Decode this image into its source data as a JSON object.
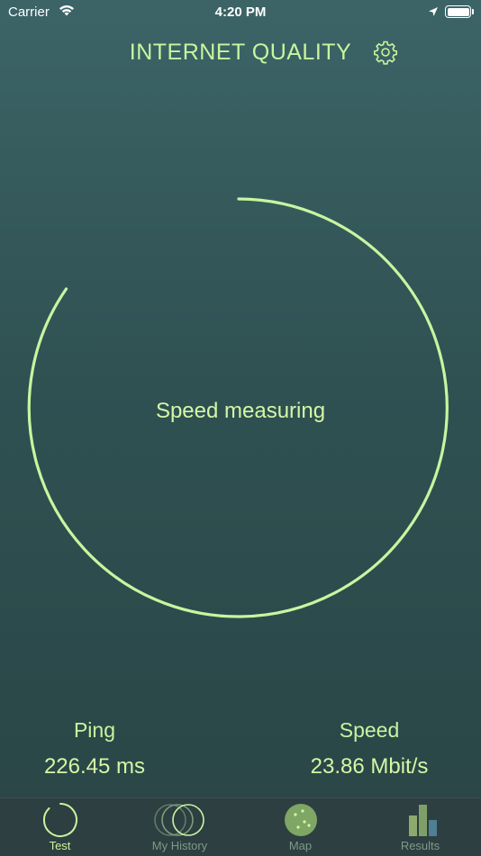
{
  "status_bar": {
    "carrier": "Carrier",
    "time": "4:20 PM"
  },
  "header": {
    "title": "INTERNET QUALITY",
    "settings_icon": "gear-icon"
  },
  "progress": {
    "label": "Speed measuring"
  },
  "stats": {
    "ping": {
      "label": "Ping",
      "value": "226.45 ms"
    },
    "speed": {
      "label": "Speed",
      "value": "23.86 Mbit/s"
    }
  },
  "tabs": [
    {
      "label": "Test",
      "icon": "test-ring-icon",
      "active": true
    },
    {
      "label": "My History",
      "icon": "history-circles-icon",
      "active": false
    },
    {
      "label": "Map",
      "icon": "map-globe-icon",
      "active": false
    },
    {
      "label": "Results",
      "icon": "results-bars-icon",
      "active": false
    }
  ],
  "colors": {
    "accent": "#c8f5a0",
    "background_top": "#3c6467",
    "background_bottom": "#2a4546",
    "tabbar": "#2d3f40"
  }
}
